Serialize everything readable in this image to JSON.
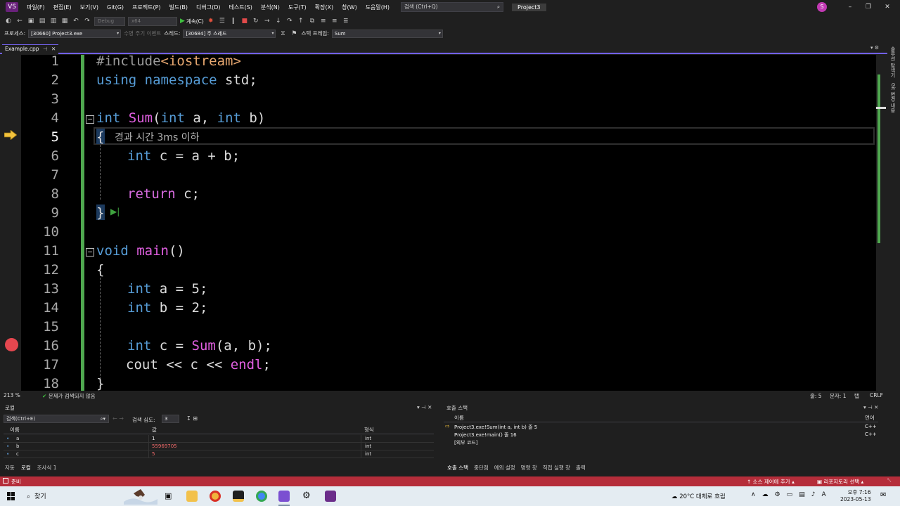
{
  "menubar": {
    "logo": "VS",
    "items": [
      "파일(F)",
      "편집(E)",
      "보기(V)",
      "Git(G)",
      "프로젝트(P)",
      "빌드(B)",
      "디버그(D)",
      "테스트(S)",
      "분석(N)",
      "도구(T)",
      "확장(X)",
      "창(W)",
      "도움말(H)"
    ],
    "search_placeholder": "검색 (Ctrl+Q)",
    "project_name": "Project3",
    "avatar_initial": "S"
  },
  "toolbar": {
    "config": "Debug",
    "platform": "x64",
    "continue_label": "계속(C)",
    "process_label": "프로세스:",
    "process_value": "[30660] Project3.exe",
    "lifecycle_label": "수명 주기 이벤트",
    "thread_label": "스레드:",
    "thread_value": "[30684] 주 스레드",
    "stackframe_label": "스택 프레임:",
    "stackframe_value": "Sum"
  },
  "document": {
    "tab_name": "Example.cpp",
    "lines": [
      {
        "n": "1"
      },
      {
        "n": "2"
      },
      {
        "n": "3"
      },
      {
        "n": "4"
      },
      {
        "n": "5"
      },
      {
        "n": "6"
      },
      {
        "n": "7"
      },
      {
        "n": "8"
      },
      {
        "n": "9"
      },
      {
        "n": "10"
      },
      {
        "n": "11"
      },
      {
        "n": "12"
      },
      {
        "n": "13"
      },
      {
        "n": "14"
      },
      {
        "n": "15"
      },
      {
        "n": "16"
      },
      {
        "n": "17"
      },
      {
        "n": "18"
      }
    ],
    "code": {
      "l1_pp": "#include",
      "l1_str": "<iostream>",
      "l2_kw1": "using",
      "l2_kw2": "namespace",
      "l2_rest": " std;",
      "l4_kw": "int",
      "l4_fn": "Sum",
      "l4_open": "(",
      "l4_kw2": "int",
      "l4_a": " a, ",
      "l4_kw3": "int",
      "l4_b": " b)",
      "l5": "{",
      "l6_kw": "int",
      "l6_rest": " c = a + b;",
      "l8_ctl": "return",
      "l8_rest": " c;",
      "l9": "}",
      "l11_kw": "void",
      "l11_fn": "main",
      "l11_rest": "()",
      "l12": "{",
      "l13_kw": "int",
      "l13_rest": " a = 5;",
      "l14_kw": "int",
      "l14_rest": " b = 2;",
      "l16_kw": "int",
      "l16_mid": " c = ",
      "l16_fn": "Sum",
      "l16_rest": "(a, b);",
      "l17_pre": "cout << c << ",
      "l17_fn": "endl",
      "l17_rest": ";",
      "l18": "}"
    },
    "perf_tip": "경과 시간 3ms 이하",
    "current_line": "5",
    "breakpoint_line": "16"
  },
  "editor_status": {
    "zoom": "213 %",
    "issues": "문제가 검색되지 않음",
    "line": "줄: 5",
    "col": "문자: 1",
    "tabs": "탭",
    "eol": "CRLF"
  },
  "side_tabs": [
    "솔루션 탐색기",
    "Git 변경 내용"
  ],
  "locals": {
    "title": "로컬",
    "search_placeholder": "검색(Ctrl+E)",
    "depth_label": "검색 심도:",
    "depth_value": "3",
    "col_name": "이름",
    "col_value": "값",
    "col_type": "형식",
    "rows": [
      {
        "name": "a",
        "value": "1",
        "type": "int",
        "changed": false
      },
      {
        "name": "b",
        "value": "55969705",
        "type": "int",
        "changed": true
      },
      {
        "name": "c",
        "value": "5",
        "type": "int",
        "changed": true
      }
    ],
    "tabs": [
      "자동",
      "로컬",
      "조사식 1"
    ]
  },
  "callstack": {
    "title": "호출 스택",
    "col_name": "이름",
    "col_lang": "언어",
    "rows": [
      {
        "frame": "Project3.exe!Sum(int a, int b) 줄 5",
        "lang": "C++"
      },
      {
        "frame": "Project3.exe!main() 줄 16",
        "lang": "C++"
      },
      {
        "frame": "[외부 코드]",
        "lang": ""
      }
    ],
    "tabs": [
      "호출 스택",
      "중단점",
      "예외 설정",
      "명령 창",
      "직접 실행 창",
      "출력"
    ]
  },
  "statusbar": {
    "ready": "준비",
    "source_control": "소스 제어에 추가",
    "repo": "리포지토리 선택"
  },
  "taskbar": {
    "search_label": "찾기",
    "weather": "20°C  대체로 흐림",
    "time": "오후 7:16",
    "date": "2023-05-13",
    "lang": "A"
  },
  "colors": {
    "accent": "#7160e8",
    "status_bar": "#b52d3a",
    "breakpoint": "#e5474f",
    "change_bar": "#4fa84f"
  }
}
